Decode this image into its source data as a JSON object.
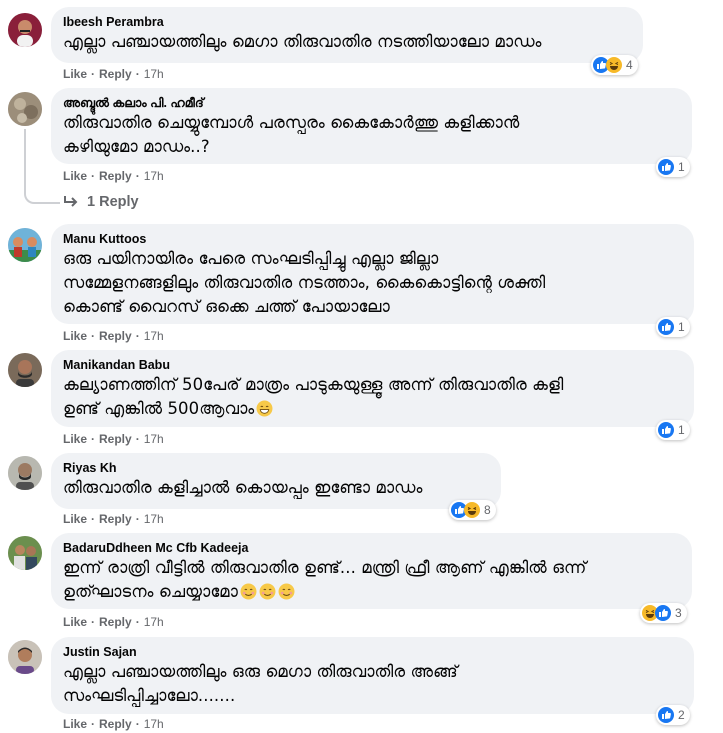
{
  "actions": {
    "like": "Like",
    "reply": "Reply",
    "separator": "·",
    "time": "17h"
  },
  "view_replies": "1 Reply",
  "comments": [
    {
      "author": "Ibeesh Perambra",
      "text": "എല്ലാ പഞ്ചായത്തിലും മെഗാ തിരുവാതിര നടത്തിയാലോ മാഡം",
      "reactions": [
        "like",
        "haha"
      ],
      "reaction_count": "4"
    },
    {
      "author": "അബ്ദുൽ കലാം പി. ഹമീദ്",
      "text": "തിരുവാതിര ചെയ്യുമ്പോൾ പരസ്പരം കൈകോർത്തു കളിക്കാൻ\nകഴിയുമോ മാഡം..?",
      "reactions": [
        "like"
      ],
      "reaction_count": "1"
    },
    {
      "author": "Manu Kuttoos",
      "text": "ഒരു പയിനായിരം പേരെ സംഘടിപ്പിച്ചു എല്ലാ ജില്ലാ\nസമ്മേളനങ്ങളിലും തിരുവാതിര നടത്താം, കൈകൊട്ടിന്റെ ശക്തി\nകൊണ്ട് വൈറസ് ഒക്കെ ചത്ത് പോയാലോ",
      "reactions": [
        "like"
      ],
      "reaction_count": "1"
    },
    {
      "author": "Manikandan Babu",
      "text": "കല്യാണത്തിന് 50പേര് മാത്രം പാടുകയുള്ളൂ അന്ന് തിരുവാതിര കളി\nഉണ്ട് എങ്കിൽ 500ആവാം",
      "reactions": [
        "like"
      ],
      "reaction_count": "1"
    },
    {
      "author": "Riyas Kh",
      "text": "തിരുവാതിര കളിച്ചാൽ കൊയപ്പം ഇണ്ടോ മാഡം",
      "reactions": [
        "like",
        "haha"
      ],
      "reaction_count": "8"
    },
    {
      "author": "BadaruDdheen Mc Cfb Kadeeja",
      "text": "ഇന്ന് രാത്രി വീട്ടിൽ തിരുവാതിര ഉണ്ട്... മന്ത്രി ഫ്രീ ആണ് എങ്കിൽ ഒന്ന്\nഉത്ഘാടനം ചെയ്യാമോ",
      "reactions": [
        "haha",
        "like"
      ],
      "reaction_count": "3"
    },
    {
      "author": "Justin Sajan",
      "text": "എല്ലാ പഞ്ചായത്തിലും ഒരു മെഗാ തിരുവാതിര അങ്ങ്\nസംഘടിപ്പിച്ചാലോ.......",
      "reactions": [
        "like"
      ],
      "reaction_count": "2"
    }
  ],
  "colors": {
    "like": "#1877f2",
    "haha": "#f7b928",
    "bubble": "#f0f2f5",
    "meta": "#65676b"
  }
}
